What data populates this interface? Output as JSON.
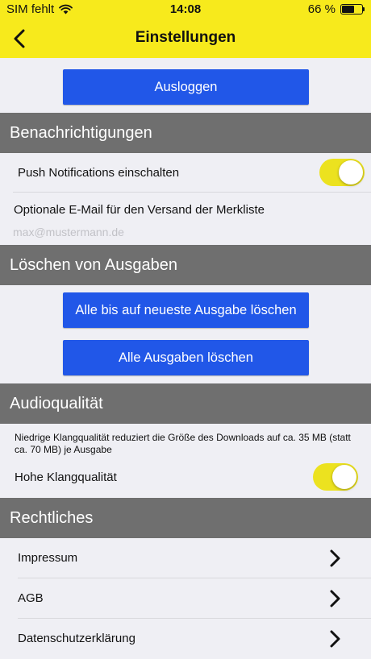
{
  "status_bar": {
    "carrier": "SIM fehlt",
    "time": "14:08",
    "battery_percent": "66 %",
    "battery_level": 0.66
  },
  "nav": {
    "title": "Einstellungen"
  },
  "logout_button": "Ausloggen",
  "sections": {
    "notifications": "Benachrichtigungen",
    "delete": "Löschen von Ausgaben",
    "audio": "Audioqualität",
    "legal": "Rechtliches"
  },
  "notifications": {
    "push_label": "Push Notifications einschalten",
    "push_enabled": true,
    "email_label": "Optionale E-Mail für den Versand der Merkliste",
    "email_placeholder": "max@mustermann.de"
  },
  "delete": {
    "keep_newest_button": "Alle bis auf neueste Ausgabe löschen",
    "delete_all_button": "Alle Ausgaben löschen"
  },
  "audio": {
    "description": "Niedrige Klangqualität reduziert die Größe des Downloads auf ca. 35 MB (statt ca. 70 MB) je Ausgabe",
    "high_quality_label": "Hohe Klangqualität",
    "high_quality_enabled": true
  },
  "legal": {
    "items": [
      {
        "label": "Impressum"
      },
      {
        "label": "AGB"
      },
      {
        "label": "Datenschutzerklärung"
      }
    ]
  },
  "colors": {
    "header": "#f7ea1c",
    "button": "#2157e8",
    "section": "#6f6f6f",
    "toggle_on": "#ece21f"
  },
  "icons": [
    "wifi-icon",
    "battery-icon",
    "back-chevron-icon",
    "chevron-right-icon"
  ]
}
